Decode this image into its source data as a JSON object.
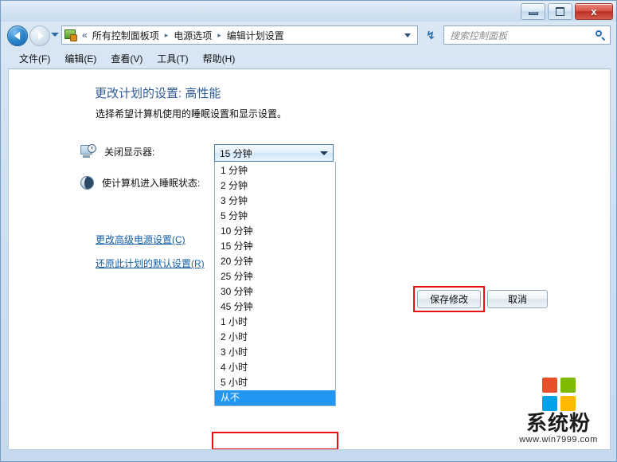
{
  "window": {
    "controls": {
      "minimize": "–",
      "maximize": "□",
      "close": "x"
    }
  },
  "navigation": {
    "back_icon": "back-arrow-icon",
    "forward_icon": "forward-arrow-icon",
    "recent_icon": "recent-pages-chevron-icon",
    "address_icon": "control-panel-icon",
    "overflow": "«",
    "breadcrumbs": [
      "所有控制面板项",
      "电源选项",
      "编辑计划设置"
    ],
    "crumb_separator": "▸",
    "refresh_icon": "↯"
  },
  "search": {
    "placeholder": "搜索控制面板",
    "value": "",
    "icon": "search-icon"
  },
  "menubar": {
    "items": [
      "文件(F)",
      "编辑(E)",
      "查看(V)",
      "工具(T)",
      "帮助(H)"
    ]
  },
  "page": {
    "title": "更改计划的设置: 高性能",
    "subtitle": "选择希望计算机使用的睡眠设置和显示设置。"
  },
  "settings": {
    "display_label": "关闭显示器:",
    "sleep_label": "使计算机进入睡眠状态:"
  },
  "combo": {
    "selected": "15 分钟",
    "caret": "dropdown-caret-icon",
    "options": [
      "1 分钟",
      "2 分钟",
      "3 分钟",
      "5 分钟",
      "10 分钟",
      "15 分钟",
      "20 分钟",
      "25 分钟",
      "30 分钟",
      "45 分钟",
      "1 小时",
      "2 小时",
      "3 小时",
      "4 小时",
      "5 小时",
      "从不"
    ],
    "highlighted": "从不"
  },
  "links": {
    "advanced": "更改高级电源设置(C)",
    "restore": "还原此计划的默认设置(R)"
  },
  "buttons": {
    "save": "保存修改",
    "cancel": "取消"
  },
  "watermark": {
    "brand": "系统粉",
    "url": "www.win7999.com",
    "logo_colors": [
      "#e8502a",
      "#7fb900",
      "#00a3e8",
      "#ffb900"
    ]
  },
  "colors": {
    "accent": "#2196f3",
    "annotation": "#e81010",
    "link": "#1560a8",
    "title": "#2f5b94"
  }
}
